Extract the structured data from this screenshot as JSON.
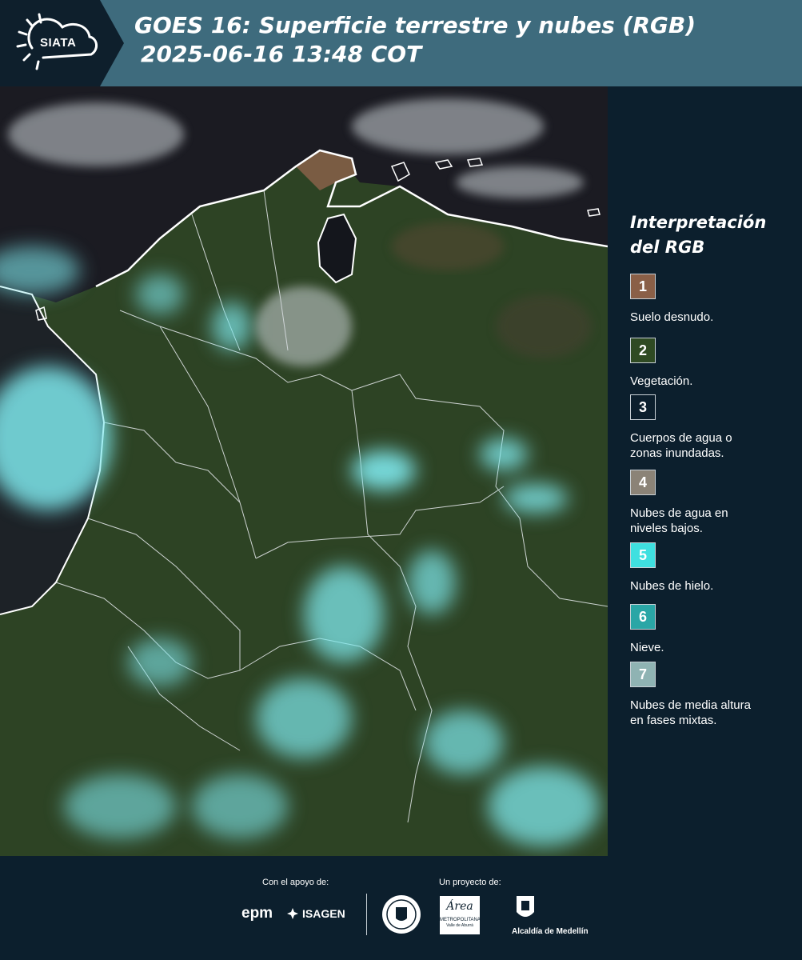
{
  "header": {
    "logo_text": "SIATA",
    "title_line1": "GOES 16: Superficie terrestre y nubes (RGB)",
    "title_line2": "2025-06-16 13:48 COT"
  },
  "legend": {
    "title_line1": "Interpretación",
    "title_line2": "del RGB",
    "items": [
      {
        "number": "1",
        "label_line1": "Suelo desnudo.",
        "label_line2": "",
        "color": "#8a5f47"
      },
      {
        "number": "2",
        "label_line1": "Vegetación.",
        "label_line2": "",
        "color": "#2f4a23"
      },
      {
        "number": "3",
        "label_line1": "Cuerpos de agua o",
        "label_line2": "zonas inundadas.",
        "color": "#0c1f2d"
      },
      {
        "number": "4",
        "label_line1": "Nubes de agua en",
        "label_line2": "niveles bajos.",
        "color": "#8b8377"
      },
      {
        "number": "5",
        "label_line1": "Nubes de hielo.",
        "label_line2": "",
        "color": "#3fe0e0"
      },
      {
        "number": "6",
        "label_line1": "Nieve.",
        "label_line2": "",
        "color": "#2aa6a6"
      },
      {
        "number": "7",
        "label_line1": "Nubes de media altura",
        "label_line2": "en fases mixtas.",
        "color": "#8fb3b3"
      }
    ]
  },
  "footer": {
    "support_label": "Con el apoyo de:",
    "project_label": "Un proyecto de:",
    "sponsor_epm": "epm",
    "sponsor_isagen": "ISAGEN",
    "partner_area": "Área",
    "partner_area_sub": "METROPOLITANA",
    "partner_area_sub2": "Valle de Aburrá",
    "partner_alcaldia": "Alcaldía de Medellín"
  }
}
